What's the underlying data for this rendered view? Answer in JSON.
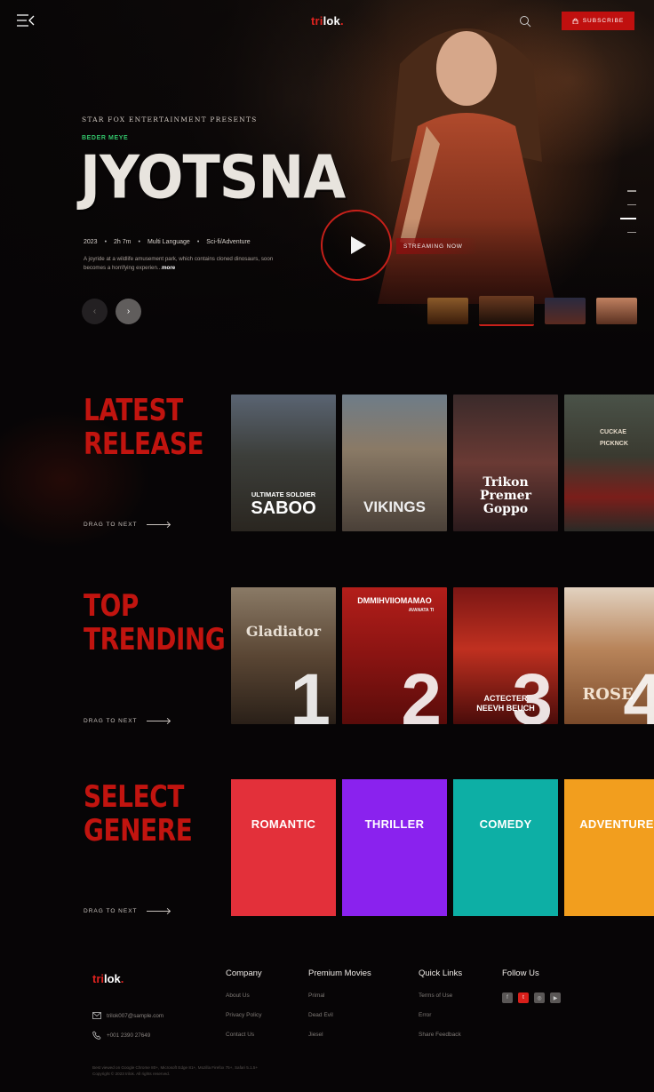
{
  "header": {
    "logo_red": "tri",
    "logo_white": "lok",
    "logo_dot": ".",
    "subscribe_label": "SUBSCRIBE",
    "icons": [
      "menu-icon",
      "search-icon",
      "lock-icon"
    ]
  },
  "hero": {
    "presents": "STAR FOX ENTERTAINMENT PRESENTS",
    "subtitle": "BEDER MEYE",
    "title": "JYOTSNA",
    "meta": {
      "year": "2023",
      "duration": "2h 7m",
      "language": "Multi Language",
      "genre": "Sci-fi/Adventure"
    },
    "description": "A joyride at a wildlife amusement park, which contains cloned dinosaurs, soon becomes a horrifying experien...",
    "more": "more",
    "streaming": "STREAMING NOW",
    "prev": "‹",
    "next": "›"
  },
  "latest": {
    "title_line1": "LATEST",
    "title_line2": "RELEASE",
    "drag": "DRAG TO NEXT",
    "cards": [
      {
        "small": "ULTIMATE SOLDIER",
        "big": "SABOO"
      },
      {
        "big": "VIKINGS"
      },
      {
        "l1": "Trikon",
        "l2": "Premer",
        "l3": "Goppo"
      },
      {
        "l1": "CUCKAE",
        "l2": "PICKNCK"
      }
    ]
  },
  "trending": {
    "title_line1": "TOP",
    "title_line2": "TRENDING",
    "drag": "DRAG TO NEXT",
    "cards": [
      {
        "label": "Gladiator",
        "num": "1"
      },
      {
        "label": "DMMIHVIIOMAMAO",
        "sub": "AVANATA TI",
        "num": "2"
      },
      {
        "label": "ACTECTER",
        "sub": "NEEVH BEUCH",
        "num": "3"
      },
      {
        "label": "ROSE",
        "num": "4"
      }
    ]
  },
  "genre": {
    "title_line1": "SELECT",
    "title_line2": "GENERE",
    "drag": "DRAG TO NEXT",
    "items": [
      {
        "label": "ROMANTIC",
        "color": "#e3303a"
      },
      {
        "label": "THRILLER",
        "color": "#8a22ee"
      },
      {
        "label": "COMEDY",
        "color": "#0dafa5"
      },
      {
        "label": "ADVENTURE",
        "color": "#f29e1e"
      }
    ]
  },
  "footer": {
    "logo_red": "tri",
    "logo_white": "lok",
    "logo_dot": ".",
    "email": "trilok007@sample.com",
    "phone": "+001 2390 27649",
    "company": {
      "title": "Company",
      "links": [
        "About Us",
        "Privacy Policy",
        "Contact Us"
      ]
    },
    "premium": {
      "title": "Premium Movies",
      "links": [
        "Primal",
        "Dead Evil",
        "Jiesel"
      ]
    },
    "quick": {
      "title": "Quick Links",
      "links": [
        "Terms of Use",
        "Error",
        "Share Feedback"
      ]
    },
    "follow": {
      "title": "Follow Us",
      "icons": [
        "facebook-icon",
        "twitter-icon",
        "instagram-icon",
        "youtube-icon"
      ]
    },
    "copy_line1": "Best viewed on Google Chrome 80+, Microsoft Edge 81+, Mozilla Firefox 75+, Safari 5.1.5+",
    "copy_line2": "Copyright © 2023 trilok. All rights reserved."
  }
}
